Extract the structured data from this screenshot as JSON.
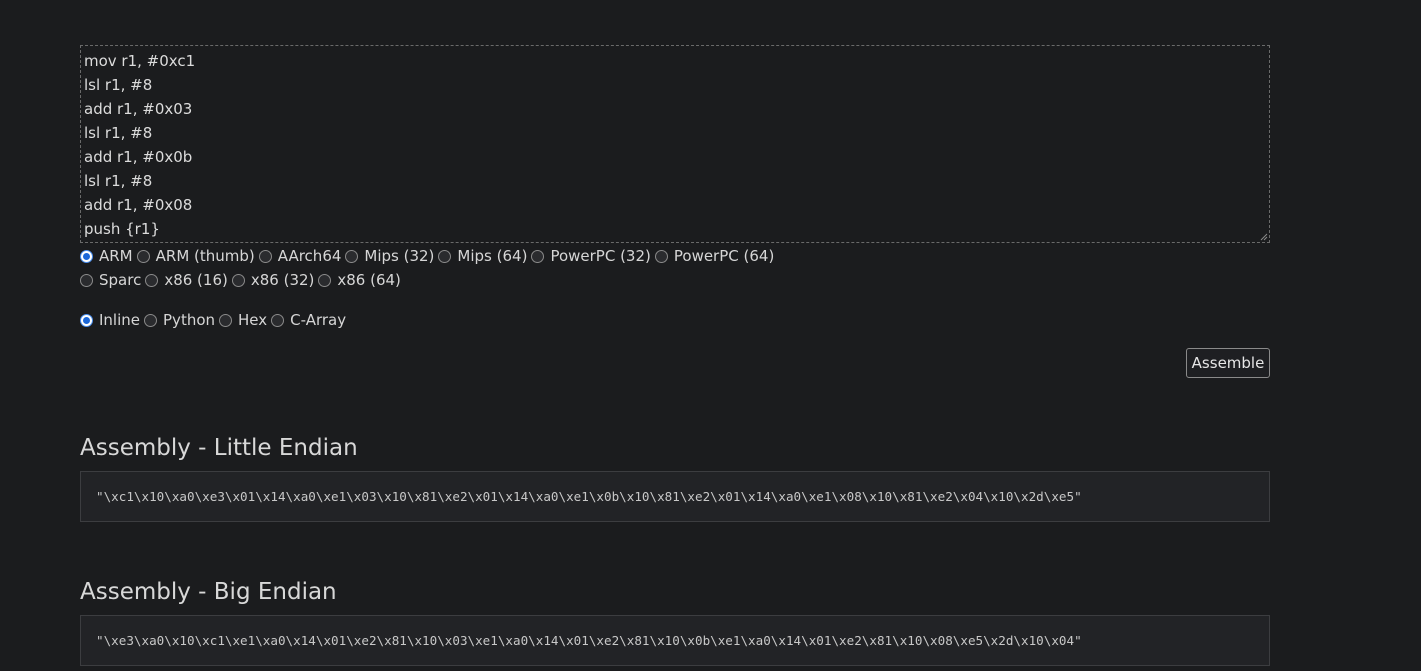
{
  "editor": {
    "lines": [
      "mov r1, #0xc1",
      "lsl r1, #8",
      "add r1, #0x03",
      "lsl r1, #8",
      "add r1, #0x0b",
      "lsl r1, #8",
      "add r1, #0x08",
      "push {r1}"
    ]
  },
  "arch": {
    "selected": "ARM",
    "row1": [
      "ARM",
      "ARM (thumb)",
      "AArch64",
      "Mips (32)",
      "Mips (64)",
      "PowerPC (32)",
      "PowerPC (64)"
    ],
    "row2": [
      "Sparc",
      "x86 (16)",
      "x86 (32)",
      "x86 (64)"
    ]
  },
  "format": {
    "selected": "Inline",
    "options": [
      "Inline",
      "Python",
      "Hex",
      "C-Array"
    ]
  },
  "assemble_label": "Assemble",
  "little_endian": {
    "title": "Assembly - Little Endian",
    "output": "\"\\xc1\\x10\\xa0\\xe3\\x01\\x14\\xa0\\xe1\\x03\\x10\\x81\\xe2\\x01\\x14\\xa0\\xe1\\x0b\\x10\\x81\\xe2\\x01\\x14\\xa0\\xe1\\x08\\x10\\x81\\xe2\\x04\\x10\\x2d\\xe5\""
  },
  "big_endian": {
    "title": "Assembly - Big Endian",
    "output": "\"\\xe3\\xa0\\x10\\xc1\\xe1\\xa0\\x14\\x01\\xe2\\x81\\x10\\x03\\xe1\\xa0\\x14\\x01\\xe2\\x81\\x10\\x0b\\xe1\\xa0\\x14\\x01\\xe2\\x81\\x10\\x08\\xe5\\x2d\\x10\\x04\""
  }
}
